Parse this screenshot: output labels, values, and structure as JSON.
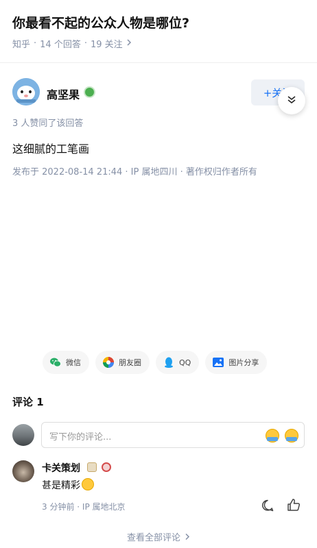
{
  "question": {
    "title": "你最看不起的公众人物是哪位?",
    "source": "知乎",
    "answers": "14 个回答",
    "followers": "19 关注"
  },
  "author": {
    "name": "高坚果",
    "follow_label": "+关注"
  },
  "answer": {
    "upvote_text": "3 人赞同了该回答",
    "content": "这细腻的工笔画",
    "publish_info": "发布于 2022-08-14 21:44 · IP 属地四川 · 著作权归作者所有"
  },
  "share": [
    {
      "label": "微信",
      "icon": "wechat-icon"
    },
    {
      "label": "朋友圈",
      "icon": "moments-icon"
    },
    {
      "label": "QQ",
      "icon": "qq-icon"
    },
    {
      "label": "图片分享",
      "icon": "image-share-icon"
    }
  ],
  "comments": {
    "title": "评论 1",
    "input_placeholder": "写下你的评论...",
    "items": [
      {
        "name": "卡关策划",
        "text": "甚是精彩",
        "time": "3 分钟前",
        "ip": "IP 属地北京"
      }
    ],
    "view_all": "查看全部评论"
  },
  "colors": {
    "accent": "#1772f6",
    "muted": "#8590a6",
    "verified": "#4caf50"
  }
}
